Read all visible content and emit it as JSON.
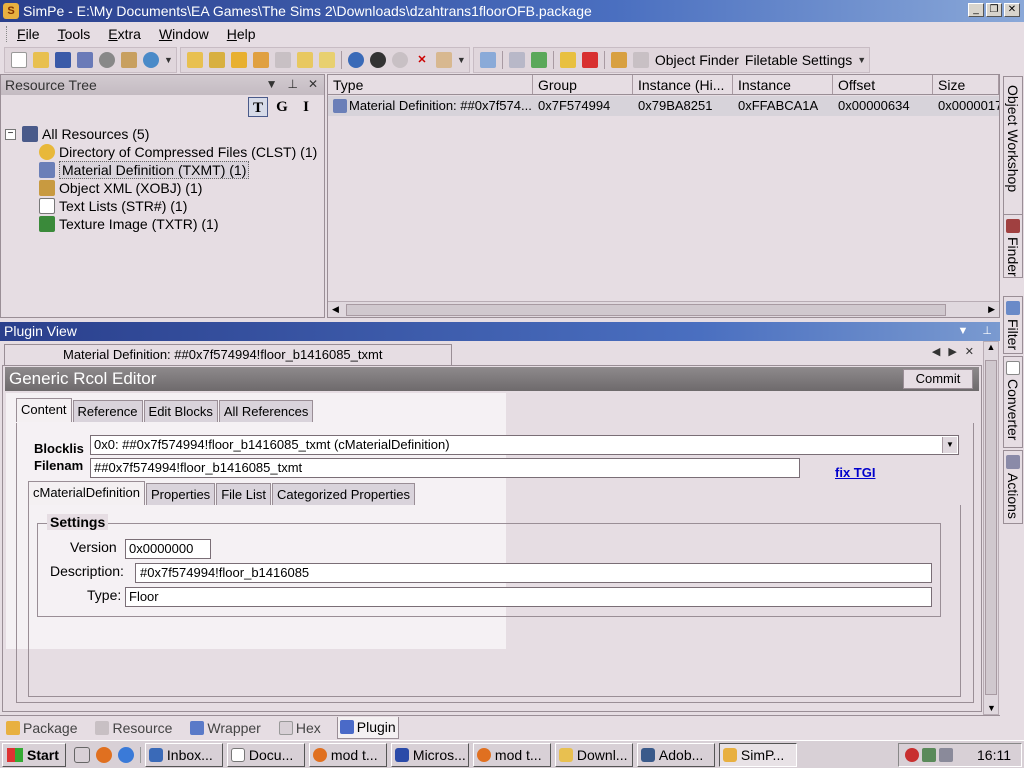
{
  "window": {
    "title": "SimPe - E:\\My Documents\\EA Games\\The Sims 2\\Downloads\\dzahtrans1floorOFB.package",
    "app_icon_glyph": "S"
  },
  "menu": [
    "File",
    "Tools",
    "Extra",
    "Window",
    "Help"
  ],
  "toolbar": {
    "object_finder": "Object Finder",
    "filetable_settings": "Filetable Settings"
  },
  "resource_tree": {
    "title": "Resource Tree",
    "filters": [
      "T",
      "G",
      "I"
    ],
    "root": "All Resources (5)",
    "items": [
      {
        "label": "Directory of Compressed Files (CLST) (1)",
        "icon": "clst-icon",
        "color": "#e8b83a"
      },
      {
        "label": "Material Definition (TXMT) (1)",
        "icon": "txmt-icon",
        "color": "#6b7fb8"
      },
      {
        "label": "Object XML (XOBJ) (1)",
        "icon": "xobj-icon",
        "color": "#c89a40"
      },
      {
        "label": "Text Lists (STR#) (1)",
        "icon": "str-icon",
        "color": "#ffffff"
      },
      {
        "label": "Texture Image (TXTR) (1)",
        "icon": "txtr-icon",
        "color": "#3a8a3a"
      }
    ]
  },
  "resource_list": {
    "columns": [
      "Type",
      "Group",
      "Instance (Hi...",
      "Instance",
      "Offset",
      "Size"
    ],
    "rows": [
      [
        "Material Definition: ##0x7f574...",
        "0x7F574994",
        "0x79BA8251",
        "0xFFABCA1A",
        "0x00000634",
        "0x0000017"
      ]
    ]
  },
  "right_dock": [
    "Object Workshop",
    "Finder",
    "Filter",
    "Converter",
    "Actions"
  ],
  "plugin_view": {
    "title": "Plugin View",
    "doc_tab": "Material Definition: ##0x7f574994!floor_b1416085_txmt",
    "editor_title": "Generic Rcol Editor",
    "commit": "Commit",
    "tabs": [
      "Content",
      "Reference",
      "Edit Blocks",
      "All References"
    ],
    "blocklist_label": "Blocklis",
    "filename_label": "Filenam",
    "blocklist_value": "0x0: ##0x7f574994!floor_b1416085_txmt (cMaterialDefinition)",
    "filename_value": "##0x7f574994!floor_b1416085_txmt",
    "fix_tgi": "fix TGI",
    "subtabs": [
      "cMaterialDefinition",
      "Properties",
      "File List",
      "Categorized Properties"
    ],
    "settings": {
      "title": "Settings",
      "version_label": "Version",
      "version_value": "0x0000000",
      "description_label": "Description:",
      "description_value": "#0x7f574994!floor_b1416085",
      "type_label": "Type:",
      "type_value": "Floor"
    }
  },
  "bottom_tabs": [
    "Package",
    "Resource",
    "Wrapper",
    "Hex",
    "Plugin"
  ],
  "taskbar": {
    "start": "Start",
    "tasks": [
      "Inbox...",
      "Docu...",
      "mod t...",
      "Micros...",
      "mod t...",
      "Downl...",
      "Adob...",
      "SimP..."
    ],
    "clock": "16:11"
  }
}
